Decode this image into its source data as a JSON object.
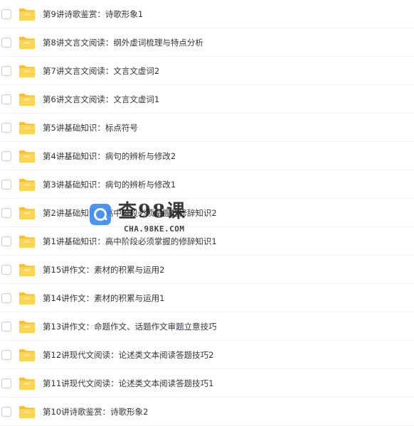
{
  "files": [
    {
      "name": "第9讲诗歌鉴赏：诗歌形象1"
    },
    {
      "name": "第8讲文言文阅读：纲外虚词梳理与特点分析"
    },
    {
      "name": "第7讲文言文阅读：文言文虚词2"
    },
    {
      "name": "第6讲文言文阅读：文言文虚词1"
    },
    {
      "name": "第5讲基础知识：标点符号"
    },
    {
      "name": "第4讲基础知识：病句的辨析与修改2"
    },
    {
      "name": "第3讲基础知识：病句的辨析与修改1"
    },
    {
      "name": "第2讲基础知识：高中阶段必须掌握的修辞知识2"
    },
    {
      "name": "第1讲基础知识：高中阶段必须掌握的修辞知识1"
    },
    {
      "name": "第15讲作文：素材的积累与运用2"
    },
    {
      "name": "第14讲作文：素材的积累与运用1"
    },
    {
      "name": "第13讲作文：命题作文、话题作文审题立意技巧"
    },
    {
      "name": "第12讲现代文阅读：论述类文本阅读答题技巧2"
    },
    {
      "name": "第11讲现代文阅读：论述类文本阅读答题技巧1"
    },
    {
      "name": "第10讲诗歌鉴赏：诗歌形象2"
    }
  ],
  "icons": {
    "folder": "folder-icon",
    "checkbox": "checkbox"
  },
  "colors": {
    "folder_body": "#ffd452",
    "folder_tab": "#f7bf2e",
    "text": "#333639",
    "divider": "#f0f1f3",
    "watermark_logo": "#3d8cf0"
  },
  "watermark": {
    "title": "查98课",
    "url": "CHA.98KE.COM"
  }
}
